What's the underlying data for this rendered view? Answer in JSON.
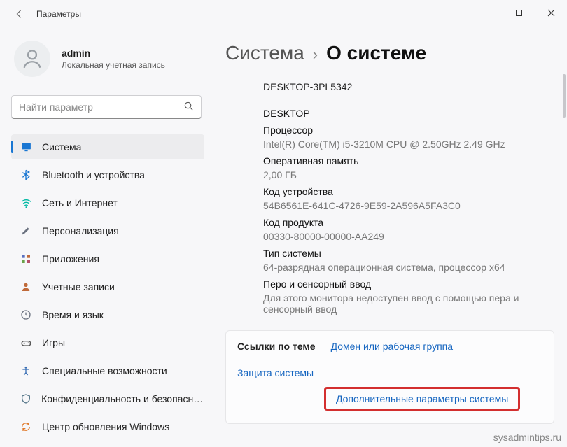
{
  "window": {
    "title": "Параметры"
  },
  "user": {
    "name": "admin",
    "role": "Локальная учетная запись"
  },
  "search": {
    "placeholder": "Найти параметр"
  },
  "nav": {
    "items": [
      {
        "label": "Система",
        "icon": "display",
        "color": "#1976d2",
        "active": true
      },
      {
        "label": "Bluetooth и устройства",
        "icon": "bluetooth",
        "color": "#1976d2"
      },
      {
        "label": "Сеть и Интернет",
        "icon": "wifi",
        "color": "#00b8a3"
      },
      {
        "label": "Персонализация",
        "icon": "brush",
        "color": "#6b7280"
      },
      {
        "label": "Приложения",
        "icon": "apps",
        "color": "#6b5b8a"
      },
      {
        "label": "Учетные записи",
        "icon": "person",
        "color": "#c06a3a"
      },
      {
        "label": "Время и язык",
        "icon": "clock",
        "color": "#6b7280"
      },
      {
        "label": "Игры",
        "icon": "game",
        "color": "#555"
      },
      {
        "label": "Специальные возможности",
        "icon": "access",
        "color": "#3a6fb5"
      },
      {
        "label": "Конфиденциальность и безопасность",
        "icon": "shield",
        "color": "#5a7a8c"
      },
      {
        "label": "Центр обновления Windows",
        "icon": "update",
        "color": "#e07a2c"
      }
    ]
  },
  "breadcrumb": {
    "parent": "Система",
    "current": "О системе"
  },
  "about": {
    "device_name": "DESKTOP-3PL5342",
    "section": "DESKTOP",
    "rows": [
      {
        "label": "Процессор",
        "value": "Intel(R) Core(TM) i5-3210M CPU @ 2.50GHz   2.49 GHz"
      },
      {
        "label": "Оперативная память",
        "value": "2,00 ГБ"
      },
      {
        "label": "Код устройства",
        "value": "54B6561E-641C-4726-9E59-2A596A5FA3C0"
      },
      {
        "label": "Код продукта",
        "value": "00330-80000-00000-AA249"
      },
      {
        "label": "Тип системы",
        "value": "64-разрядная операционная система, процессор x64"
      },
      {
        "label": "Перо и сенсорный ввод",
        "value": "Для этого монитора недоступен ввод с помощью пера и сенсорный ввод"
      }
    ]
  },
  "links": {
    "label": "Ссылки по теме",
    "items": [
      "Домен или рабочая группа",
      "Защита системы",
      "Дополнительные параметры системы"
    ]
  },
  "watermark": "sysadmintips.ru"
}
